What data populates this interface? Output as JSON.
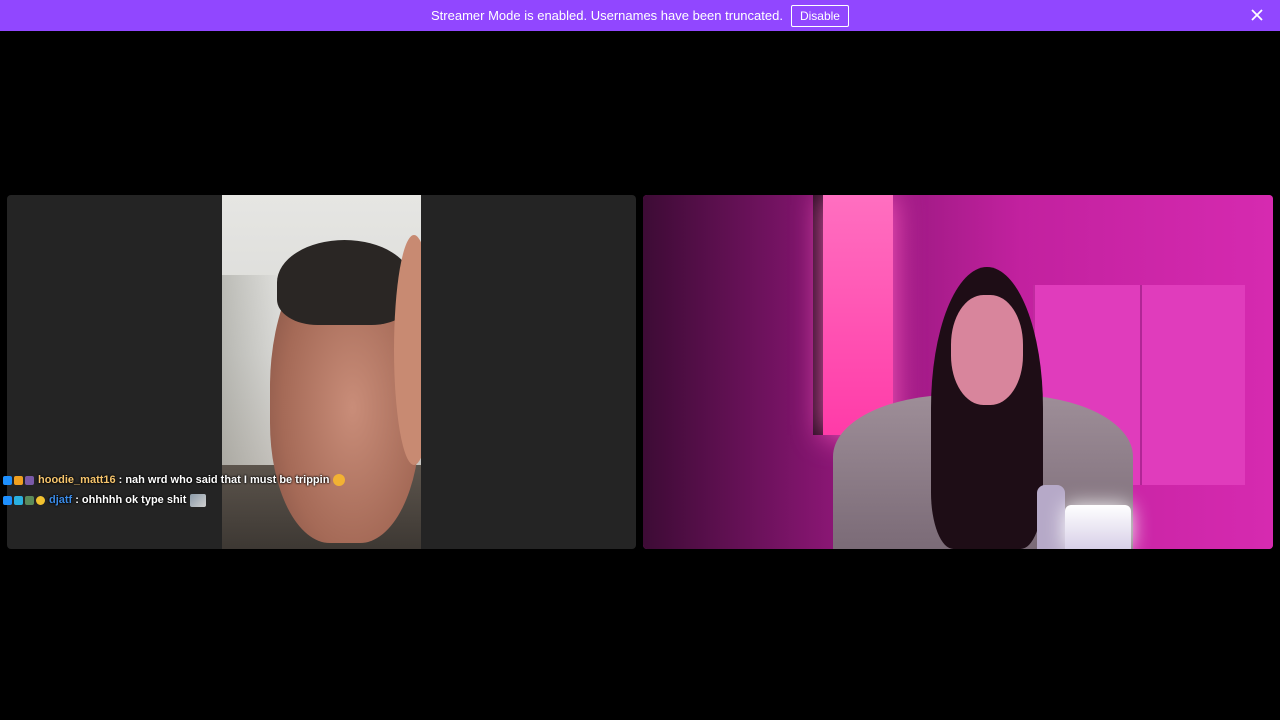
{
  "banner": {
    "message": "Streamer Mode is enabled. Usernames have been truncated.",
    "disable_label": "Disable",
    "background_color": "#9147ff",
    "close_icon": "close-icon"
  },
  "participants": [
    {
      "id": "left",
      "tile_background": "#242424"
    },
    {
      "id": "right",
      "tile_background": "#b51f94"
    }
  ],
  "chat": {
    "messages": [
      {
        "username": "hoodie_matt16",
        "username_color": "#f6c56d",
        "separator": ":",
        "text": "nah wrd who said that I must be trippin",
        "badges": [
          "prime-badge",
          "gift-badge",
          "cheer-badge"
        ],
        "emote": "heart-eyes-emoji"
      },
      {
        "username": "djatf",
        "username_color": "#3a8ae6",
        "separator": ":",
        "text": "ohhhhh ok type shit",
        "badges": [
          "prime-badge",
          "gift-badge",
          "sub-badge",
          "bits-badge"
        ],
        "emote": "image-emote"
      }
    ]
  }
}
